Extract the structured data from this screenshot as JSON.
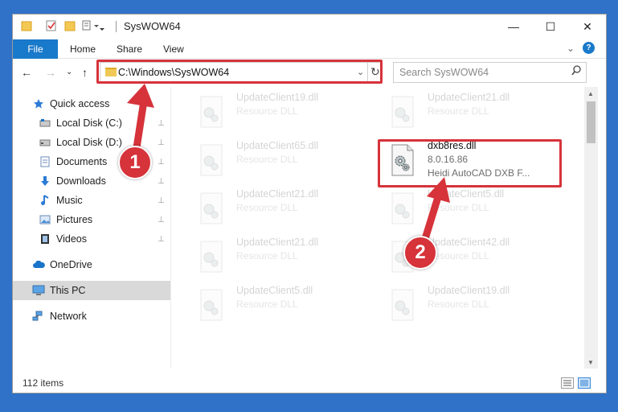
{
  "window": {
    "title": "SysWOW64",
    "minimize_glyph": "—",
    "maximize_glyph": "☐",
    "close_glyph": "✕"
  },
  "ribbon": {
    "tabs": [
      "File",
      "Home",
      "Share",
      "View"
    ],
    "help_glyph": "?",
    "collapse_glyph": "⌄"
  },
  "address": {
    "path": "C:\\Windows\\SysWOW64",
    "dropdown_glyph": "⌄",
    "refresh_glyph": "↻"
  },
  "search": {
    "placeholder": "Search SysWOW64",
    "icon": "search-icon"
  },
  "nav": {
    "back_glyph": "←",
    "forward_glyph": "→",
    "recent_glyph": "⌄",
    "up_glyph": "↑",
    "items": [
      {
        "label": "Quick access",
        "icon": "star-icon",
        "pinned": false
      },
      {
        "label": "Local Disk (C:)",
        "icon": "drive-icon",
        "pinned": true
      },
      {
        "label": "Local Disk (D:)",
        "icon": "drive-icon",
        "pinned": true
      },
      {
        "label": "Documents",
        "icon": "documents-icon",
        "pinned": true
      },
      {
        "label": "Downloads",
        "icon": "downloads-icon",
        "pinned": true
      },
      {
        "label": "Music",
        "icon": "music-icon",
        "pinned": true
      },
      {
        "label": "Pictures",
        "icon": "pictures-icon",
        "pinned": true
      },
      {
        "label": "Videos",
        "icon": "videos-icon",
        "pinned": true
      },
      {
        "label": "OneDrive",
        "icon": "cloud-icon",
        "pinned": false
      },
      {
        "label": "This PC",
        "icon": "computer-icon",
        "pinned": false,
        "selected": true
      },
      {
        "label": "Network",
        "icon": "network-icon",
        "pinned": false
      }
    ],
    "pin_glyph": "📌"
  },
  "files": [
    {
      "name": "UpdateClient19.dll",
      "type": "Resource DLL",
      "faded": true
    },
    {
      "name": "UpdateClient21.dll",
      "type": "Resource DLL",
      "faded": true
    },
    {
      "name": "UpdateClient65.dll",
      "type": "Resource DLL",
      "faded": true
    },
    {
      "name": "dxb8res.dll",
      "version": "8.0.16.86",
      "description": "Heidi AutoCAD DXB F...",
      "faded": false
    },
    {
      "name": "UpdateClient21.dll",
      "type": "Resource DLL",
      "faded": true
    },
    {
      "name": "UpdateClient5.dll",
      "type": "Resource DLL",
      "faded": true
    },
    {
      "name": "UpdateClient21.dll",
      "type": "Resource DLL",
      "faded": true
    },
    {
      "name": "UpdateClient42.dll",
      "type": "Resource DLL",
      "faded": true
    },
    {
      "name": "UpdateClient5.dll",
      "type": "Resource DLL",
      "faded": true
    },
    {
      "name": "UpdateClient19.dll",
      "type": "Resource DLL",
      "faded": true
    }
  ],
  "status": {
    "item_count": "112 items"
  },
  "annotations": {
    "step1": "1",
    "step2": "2",
    "color": "#d6333b"
  },
  "colors": {
    "accent": "#1979ca",
    "selection": "#d9d9d9",
    "desktop": "#2f72c8"
  }
}
